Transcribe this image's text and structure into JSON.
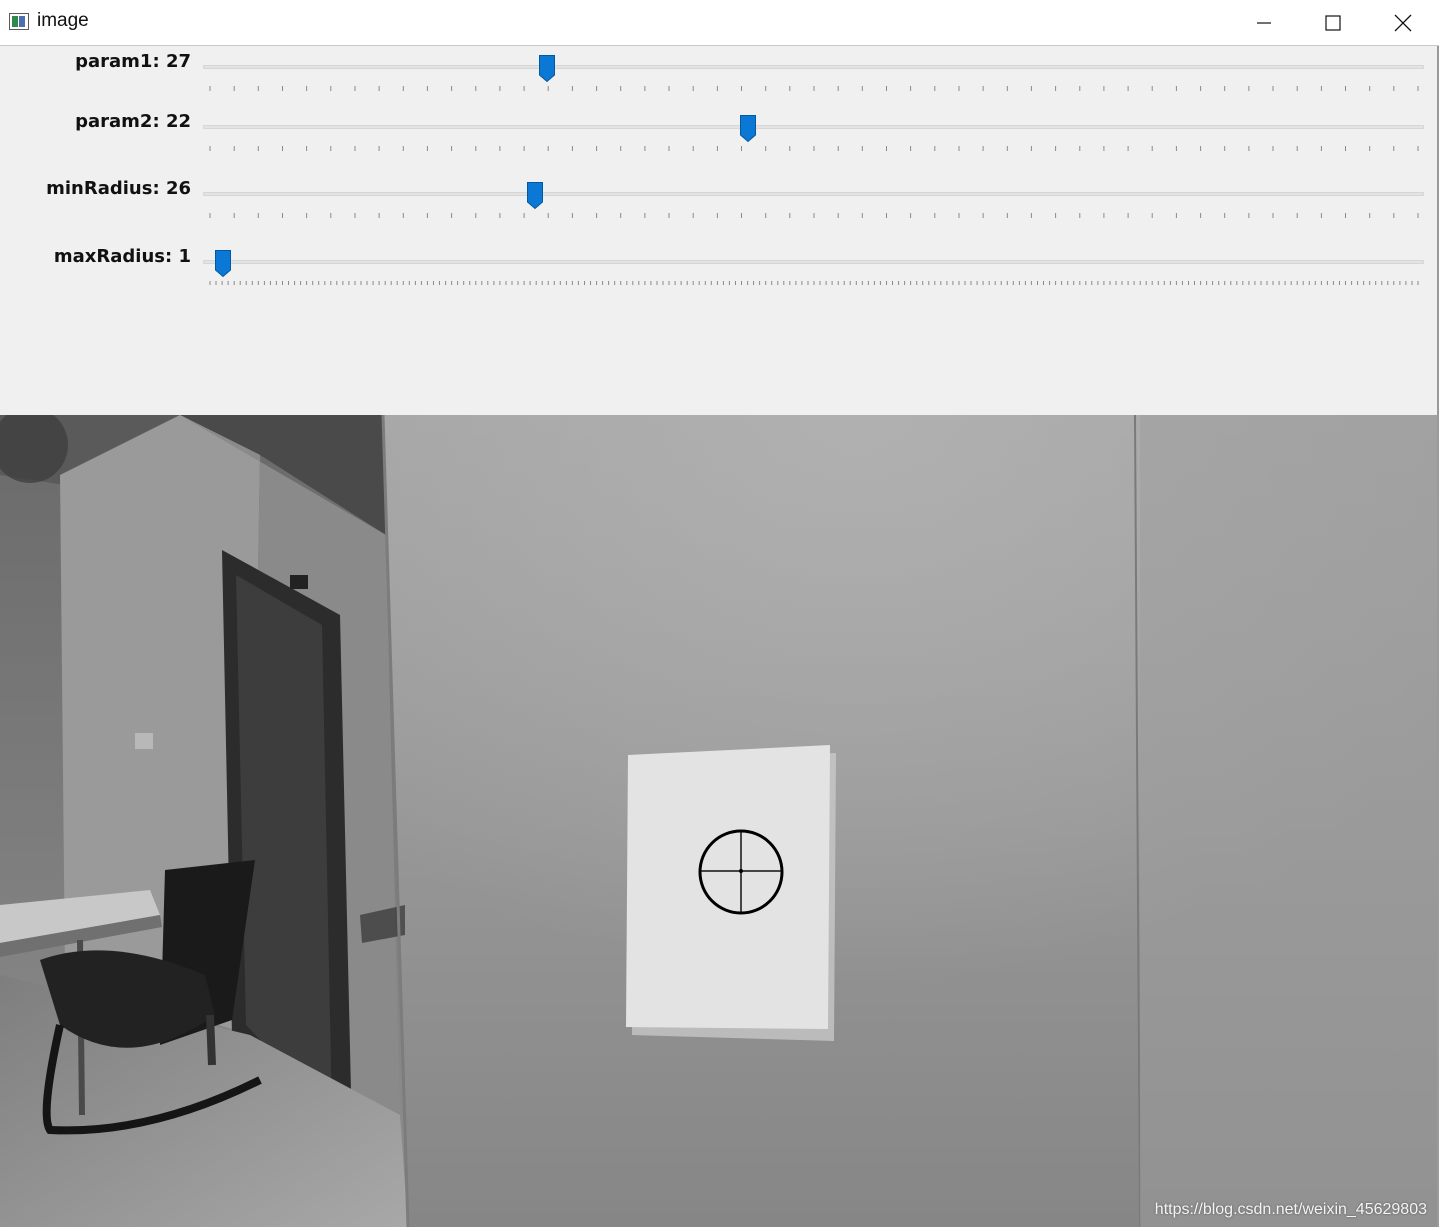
{
  "window": {
    "title": "image",
    "icon": "opencv-window-icon",
    "buttons": [
      "minimize-icon",
      "maximize-icon",
      "close-icon"
    ]
  },
  "trackbars": [
    {
      "name": "param1",
      "label": "param1",
      "value": "27",
      "position_fraction": 0.275,
      "tick_count": 51
    },
    {
      "name": "param2",
      "label": "param2",
      "value": "22",
      "position_fraction": 0.442,
      "tick_count": 51
    },
    {
      "name": "minRadius",
      "label": "minRadius",
      "value": "26",
      "position_fraction": 0.265,
      "tick_count": 51
    },
    {
      "name": "maxRadius",
      "label": "maxRadius",
      "value": "1",
      "position_fraction": 0.005,
      "tick_count": 201
    }
  ],
  "colors": {
    "thumb": "#0a78d4",
    "panel_bg": "#f0f0f0",
    "detected_circle": "#000000"
  },
  "image": {
    "description_icon": "grayscale-camera-frame",
    "watermark": "https://blog.csdn.net/weixin_45629803"
  }
}
